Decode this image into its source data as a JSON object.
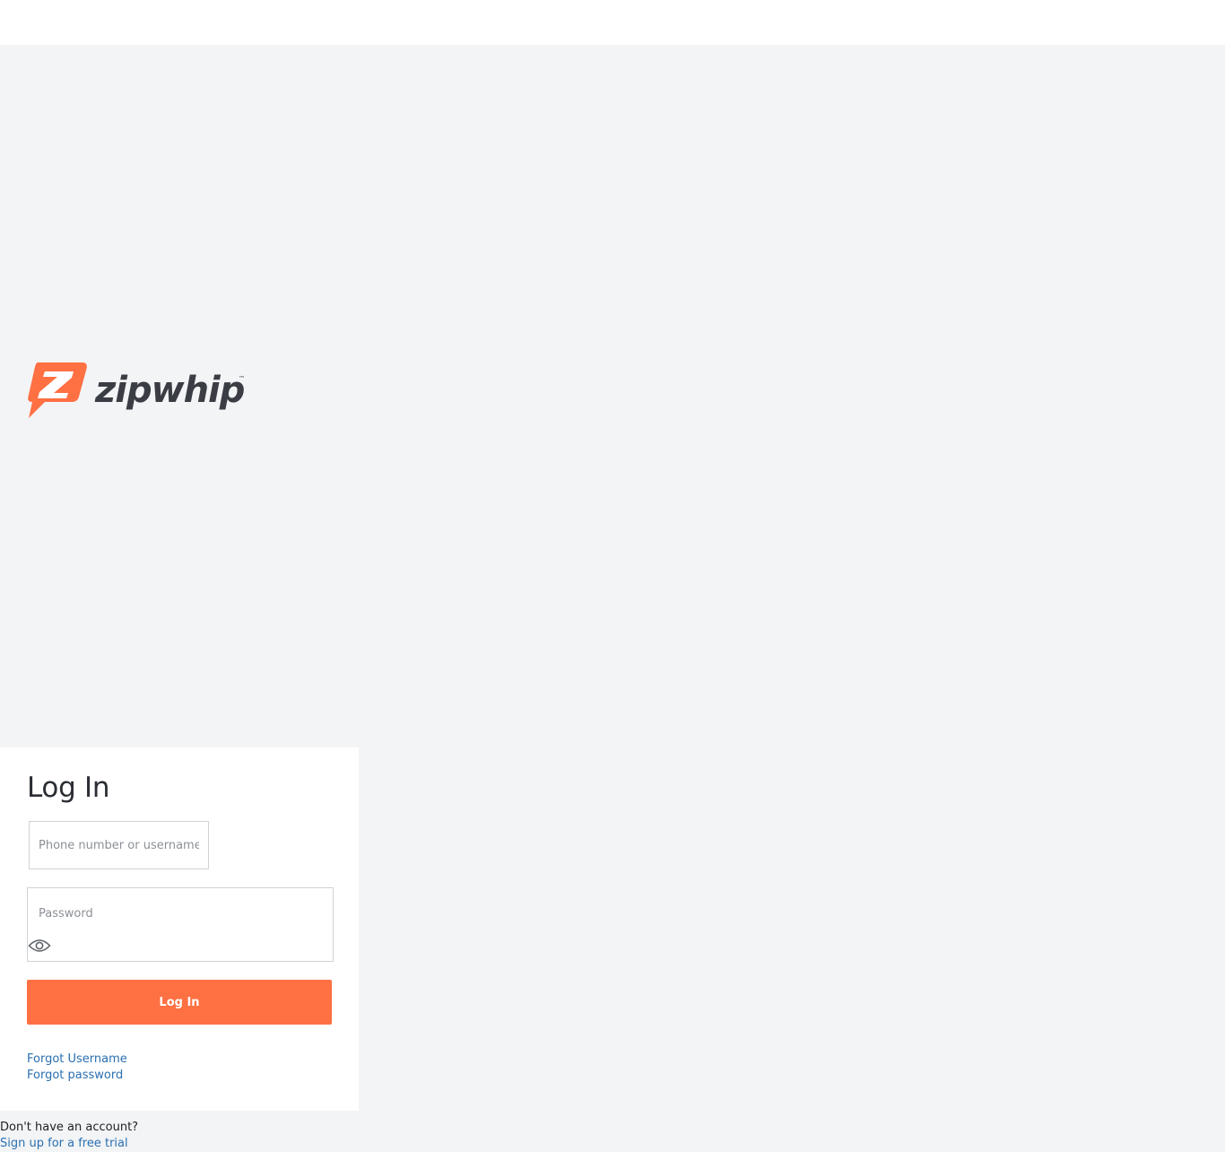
{
  "brand": {
    "name": "zipwhip",
    "logo_icon": "zipwhip-logo-icon",
    "trademark": "™",
    "accent_color": "#ff7043",
    "wordmark_color": "#3a3d44"
  },
  "login": {
    "title": "Log In",
    "username_placeholder": "Phone number or username",
    "password_placeholder": "Password",
    "show_password_icon": "eye-icon",
    "submit_label": "Log In",
    "forgot_username": "Forgot Username",
    "forgot_password": "Forgot password"
  },
  "signup": {
    "prompt": "Don't have an account?",
    "link_label": "Sign up for a free trial"
  }
}
